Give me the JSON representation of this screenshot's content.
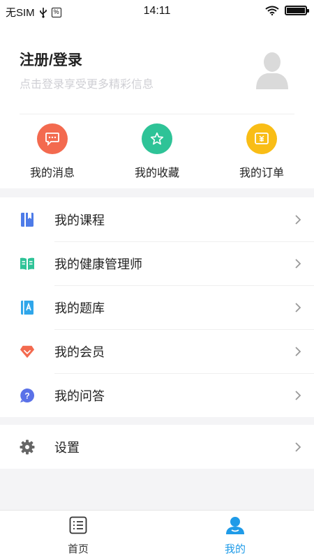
{
  "status_bar": {
    "carrier": "无SIM",
    "time": "14:11"
  },
  "profile": {
    "title": "注册/登录",
    "subtitle": "点击登录享受更多精彩信息"
  },
  "quick_actions": [
    {
      "label": "我的消息",
      "icon": "message-icon",
      "color": "#f36a4f"
    },
    {
      "label": "我的收藏",
      "icon": "star-icon",
      "color": "#2ec397"
    },
    {
      "label": "我的订单",
      "icon": "order-icon",
      "color": "#f9bd16"
    }
  ],
  "menu_main": [
    {
      "label": "我的课程",
      "icon": "book-icon",
      "color": "#4d7be8"
    },
    {
      "label": "我的健康管理师",
      "icon": "open-book-icon",
      "color": "#2ec397"
    },
    {
      "label": "我的题库",
      "icon": "question-bank-icon",
      "color": "#2fa6ea"
    },
    {
      "label": "我的会员",
      "icon": "membership-gem-icon",
      "color": "#f36a4f"
    },
    {
      "label": "我的问答",
      "icon": "question-bubble-icon",
      "color": "#5a71e8"
    }
  ],
  "menu_settings": [
    {
      "label": "设置",
      "icon": "gear-icon",
      "color": "#666666"
    }
  ],
  "tabbar": {
    "home_label": "首页",
    "mine_label": "我的",
    "active_color": "#1f9be8",
    "inactive_color": "#333333"
  }
}
